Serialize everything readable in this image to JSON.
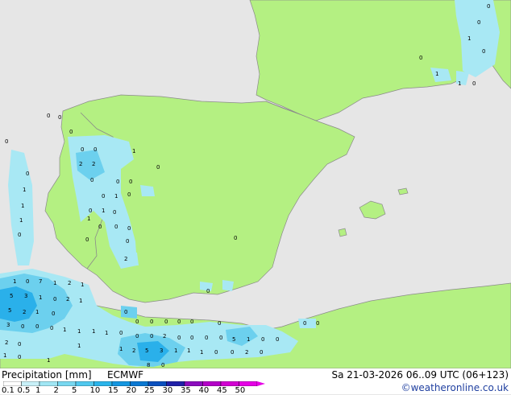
{
  "footer": {
    "title": "Precipitation [mm]",
    "model": "ECMWF",
    "valid_time": "Sa 21-03-2026 06..09 UTC (06+123)",
    "credit": "©weatheronline.co.uk"
  },
  "legend": {
    "ticks": [
      "0.1",
      "0.5",
      "1",
      "2",
      "5",
      "10",
      "15",
      "20",
      "25",
      "30",
      "35",
      "40",
      "45",
      "50"
    ],
    "colors": [
      "#ffffff",
      "#c8f0f8",
      "#a0e6f4",
      "#78d8f0",
      "#50c8ee",
      "#2ab4ea",
      "#1496e0",
      "#0a78d2",
      "#0a50be",
      "#2020a8",
      "#8c0cbe",
      "#b400c8",
      "#d200d2",
      "#e600e6"
    ]
  },
  "map_colors": {
    "sea": "#e6e6e6",
    "land": "#b4f082",
    "border": "#8a8a8a",
    "light_precip": "#a8e8f4",
    "mid_precip": "#6cd0ee",
    "heavy_precip": "#2ab0ea"
  },
  "precip_labels": [
    "0",
    "1",
    "2",
    "5",
    "7",
    "3",
    "8"
  ]
}
